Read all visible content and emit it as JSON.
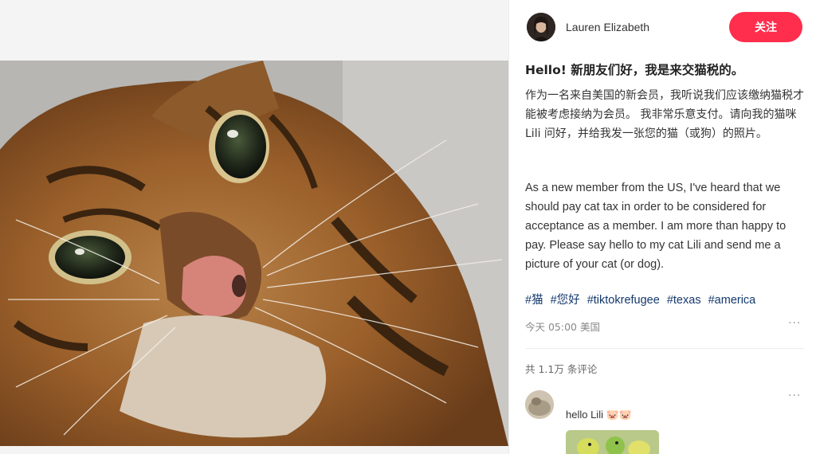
{
  "post": {
    "author": "Lauren Elizabeth",
    "follow_label": "关注",
    "title": "Hello! 新朋友们好，我是来交猫税的。",
    "body_zh": "作为一名来自美国的新会员，我听说我们应该缴纳猫税才能被考虑接纳为会员。 我非常乐意支付。请向我的猫咪 Lili 问好，并给我发一张您的猫（或狗）的照片。",
    "body_en": "As a new member from the US, I've heard that we should pay cat tax in order to be considered for acceptance as a member. I am more than happy to pay. Please say hello to my cat Lili and send me a picture of your cat (or dog).",
    "tags": [
      "#猫",
      "#您好",
      "#tiktokrefugee",
      "#texas",
      "#america"
    ],
    "meta": "今天 05:00 美国",
    "more_label": "···"
  },
  "comments": {
    "count_label": "共 1.1万 条评论",
    "first": {
      "text": "hello Lili",
      "emoji": "🐷🐷",
      "more_label": "···"
    }
  },
  "icons": {
    "photo": "cat-photo",
    "avatar": "author-avatar",
    "commenter_avatar": "commenter-avatar",
    "comment_image": "comment-image-parakeet"
  },
  "colors": {
    "accent": "#ff2e4d",
    "hashtag": "#13386c",
    "meta": "#888888"
  }
}
